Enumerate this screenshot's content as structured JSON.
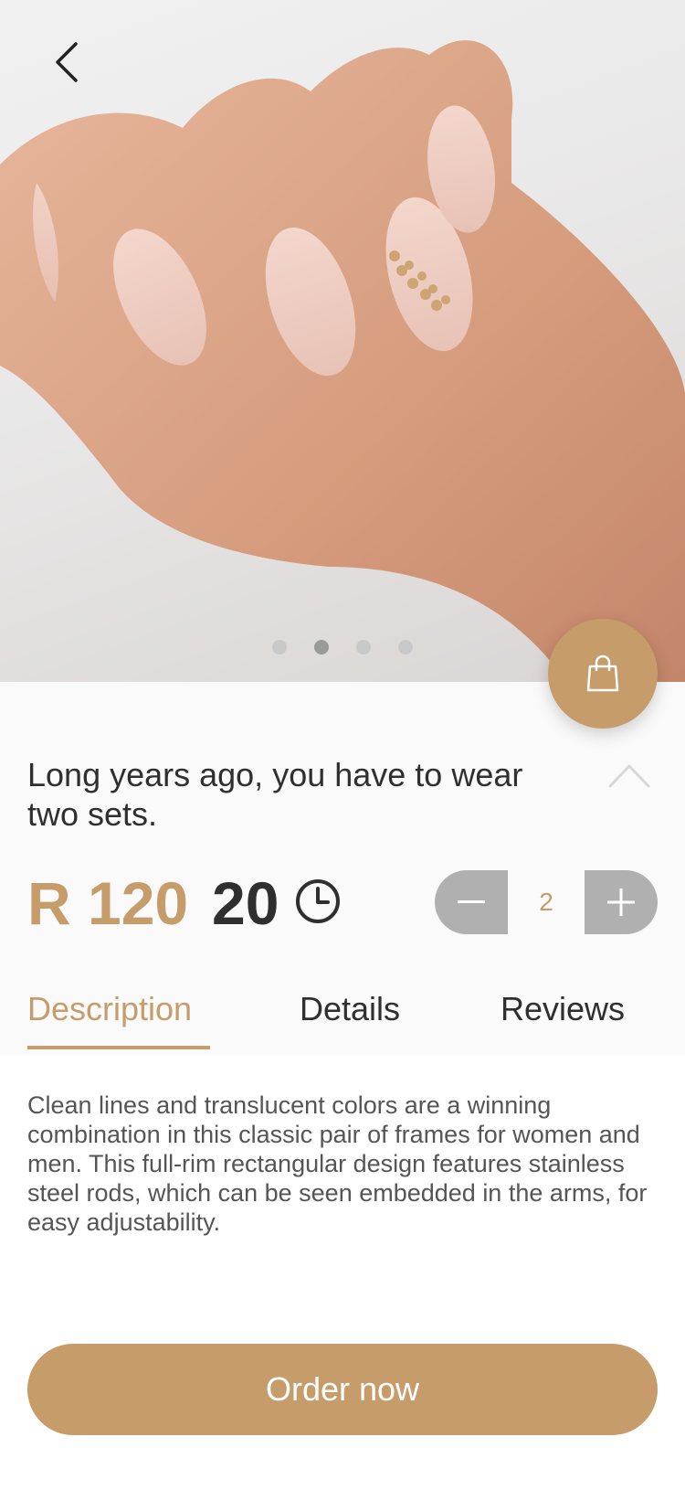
{
  "hero": {
    "back_icon": "chevron-left-icon",
    "carousel": {
      "count": 4,
      "active_index": 1
    }
  },
  "cart_button": {
    "icon": "shopping-bag-icon"
  },
  "product": {
    "title": "Long years ago, you have to wear two sets.",
    "price": "R 120",
    "duration": "20",
    "duration_icon": "clock-icon",
    "quantity": "2"
  },
  "tabs": [
    {
      "label": "Description",
      "active": true
    },
    {
      "label": "Details",
      "active": false
    },
    {
      "label": "Reviews",
      "active": false
    }
  ],
  "description": "Clean lines and translucent colors are a winning combination in this classic pair of frames for women and men. This full-rim rectangular design features stainless steel rods, which can be seen embedded in the arms, for easy adjustability.",
  "order_button": {
    "label": "Order now"
  },
  "colors": {
    "accent": "#c79c6b",
    "stepper": "#b0b0b0",
    "text": "#2f2f2f"
  }
}
